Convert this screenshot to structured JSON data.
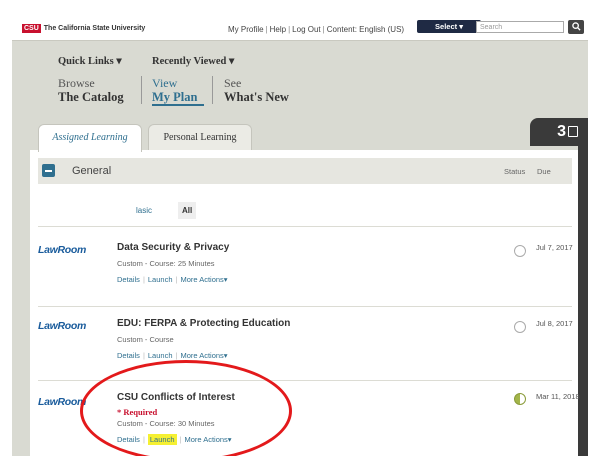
{
  "header": {
    "logo_mark": "CSU",
    "logo_text": "The California State University",
    "links": [
      "My Profile",
      "Help",
      "Log Out",
      "Content: English (US)"
    ],
    "select_label": "Select ▾",
    "search_placeholder": "Search",
    "search_icon": "search-icon"
  },
  "nav": {
    "quick_links": "Quick Links ▾",
    "recently_viewed": "Recently Viewed ▾",
    "items": [
      {
        "l1": "Browse",
        "l2": "The Catalog"
      },
      {
        "l1": "View",
        "l2": "My Plan"
      },
      {
        "l1": "See",
        "l2": "What's New"
      }
    ]
  },
  "tabs": {
    "assigned": "Assigned Learning",
    "personal": "Personal Learning",
    "count": "3",
    "count_icon": "clipboard-check-icon"
  },
  "group": {
    "title": "General",
    "status_header": "Status",
    "due_header": "Due",
    "filter_basic": "lasic",
    "filter_all": "All"
  },
  "items": [
    {
      "logo": "LawRoom",
      "title": "Data Security & Privacy",
      "required": "",
      "meta": "Custom - Course: 25 Minutes",
      "actions": [
        "Details",
        "Launch",
        "More Actions▾"
      ],
      "due": "Jul 7, 2017",
      "status": "not-started"
    },
    {
      "logo": "LawRoom",
      "title": "EDU: FERPA & Protecting Education",
      "required": "",
      "meta": "Custom - Course",
      "actions": [
        "Details",
        "Launch",
        "More Actions▾"
      ],
      "due": "Jul 8, 2017",
      "status": "not-started"
    },
    {
      "logo": "LawRoom",
      "title": "CSU Conflicts of Interest",
      "required": "* Required",
      "meta": "Custom - Course: 30 Minutes",
      "actions": [
        "Details",
        "Launch",
        "More Actions▾"
      ],
      "due": "Mar 11, 2018",
      "status": "in-progress"
    }
  ],
  "colors": {
    "accent": "#2f6f8f",
    "annotation": "#e3191b",
    "highlight": "#f5f032",
    "brand": "#c8102e"
  }
}
